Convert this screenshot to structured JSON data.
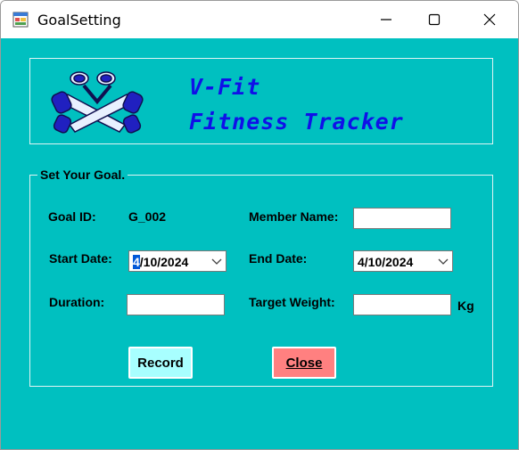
{
  "window": {
    "title": "GoalSetting",
    "icons": {
      "app": "form-icon",
      "minimize": "minimize-icon",
      "maximize": "maximize-icon",
      "close": "close-icon"
    }
  },
  "banner": {
    "logo": "dumbbell-logo",
    "line1": "V-Fit",
    "line2": "Fitness Tracker"
  },
  "form": {
    "group_title": "Set Your Goal.",
    "goal_id_label": "Goal ID:",
    "goal_id_value": "G_002",
    "member_name_label": "Member Name:",
    "member_name_value": "",
    "start_date_label": "Start Date:",
    "start_date_value": "4/10/2024",
    "start_date_selected_part": "4",
    "start_date_rest": "/10/2024",
    "end_date_label": "End Date:",
    "end_date_value": "4/10/2024",
    "duration_label": "Duration:",
    "duration_value": "",
    "target_weight_label": "Target Weight:",
    "target_weight_value": "",
    "weight_unit": "Kg"
  },
  "buttons": {
    "record_label": "Record",
    "close_label": "Close",
    "record_color": "#a8ffff",
    "close_color": "#ff8080"
  },
  "colors": {
    "client_bg": "#00c0c0",
    "banner_text": "#1010e8",
    "selection": "#0058d8"
  }
}
